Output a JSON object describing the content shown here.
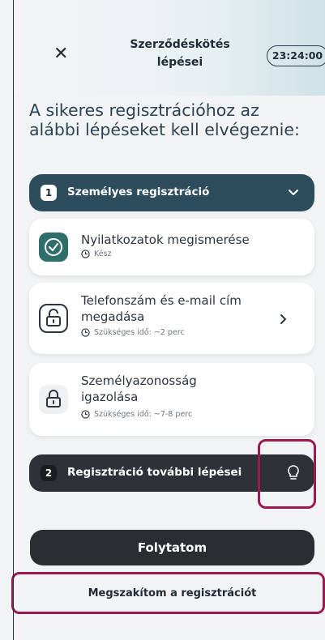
{
  "header": {
    "close_icon": "close-icon",
    "title": "Szerződéskötés lépései",
    "timer": "23:24:00"
  },
  "headline": "A sikeres regisztrációhoz az alábbi lépéseket kell elvégeznie:",
  "section1": {
    "number": "1",
    "label": "Személyes regisztráció",
    "icon": "chevron-down-icon"
  },
  "steps": [
    {
      "title": "Nyilatkozatok megismerése",
      "status": "Kész",
      "icon": "check-circle-icon"
    },
    {
      "title": "Telefonszám és e-mail cím megadása",
      "status": "Szükséges idő: ~2 perc",
      "icon": "unlock-icon",
      "action_icon": "chevron-right-icon"
    },
    {
      "title": "Személyazonosság igazolása",
      "status": "Szükséges idő: ~7-8 perc",
      "icon": "lock-icon"
    }
  ],
  "section2": {
    "number": "2",
    "label": "Regisztráció további lépései",
    "icon": "lightbulb-icon"
  },
  "actions": {
    "continue": "Folytatom",
    "cancel": "Megszakítom a regisztrációt"
  },
  "colors": {
    "primary": "#2a2d31",
    "section_active": "#2e4d5c",
    "success": "#2f6f6a",
    "highlight": "#9b1b50"
  }
}
